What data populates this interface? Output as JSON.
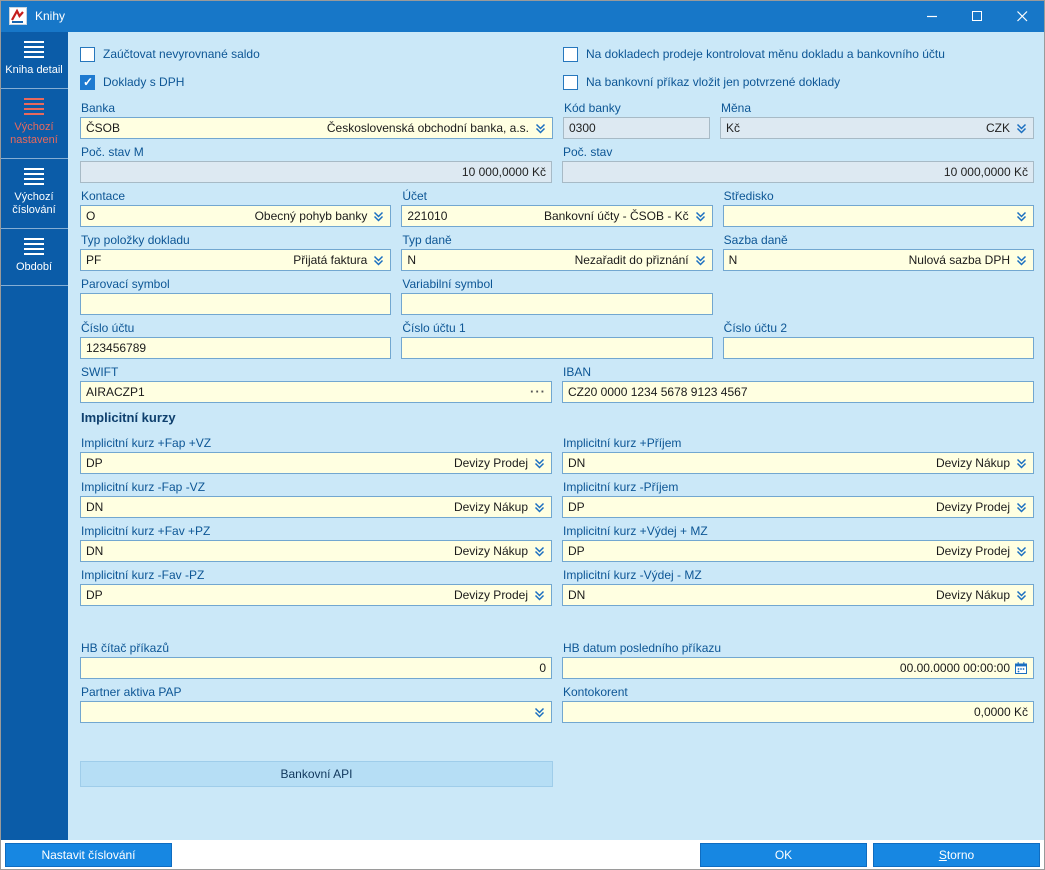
{
  "window": {
    "title": "Knihy"
  },
  "sidebar": {
    "items": [
      {
        "label": "Kniha detail",
        "active": false
      },
      {
        "label": "Výchozí nastavení",
        "active": true
      },
      {
        "label": "Výchozí číslování",
        "active": false
      },
      {
        "label": "Období",
        "active": false
      }
    ]
  },
  "checkboxes": {
    "saldo": {
      "label": "Zaúčtovat nevyrovnané saldo",
      "checked": false
    },
    "dph": {
      "label": "Doklady s DPH",
      "checked": true
    },
    "kontrola_meny": {
      "label": "Na dokladech prodeje kontrolovat měnu dokladu a bankovního účtu",
      "checked": false
    },
    "potvrzene_doklady": {
      "label": "Na bankovní příkaz vložit jen potvrzené doklady",
      "checked": false
    }
  },
  "fields": {
    "banka": {
      "label": "Banka",
      "code": "ČSOB",
      "name": "Československá obchodní banka, a.s."
    },
    "kod_banky": {
      "label": "Kód banky",
      "value": "0300"
    },
    "mena": {
      "label": "Měna",
      "code": "Kč",
      "name": "CZK"
    },
    "poc_stav_m": {
      "label": "Poč. stav M",
      "value": "10 000,0000 Kč"
    },
    "poc_stav": {
      "label": "Poč. stav",
      "value": "10 000,0000 Kč"
    },
    "kontace": {
      "label": "Kontace",
      "code": "O",
      "name": "Obecný pohyb banky"
    },
    "ucet": {
      "label": "Účet",
      "code": "221010",
      "name": "Bankovní účty - ČSOB - Kč"
    },
    "stredisko": {
      "label": "Středisko",
      "code": "",
      "name": ""
    },
    "typ_polozky_dokladu": {
      "label": "Typ položky dokladu",
      "code": "PF",
      "name": "Přijatá faktura"
    },
    "typ_dane": {
      "label": "Typ daně",
      "code": "N",
      "name": "Nezařadit do přiznání"
    },
    "sazba_dane": {
      "label": "Sazba daně",
      "code": "N",
      "name": "Nulová sazba DPH"
    },
    "parovaci_symbol": {
      "label": "Parovací symbol",
      "value": ""
    },
    "variabilni_symbol": {
      "label": "Variabilní symbol",
      "value": ""
    },
    "cislo_uctu": {
      "label": "Číslo účtu",
      "value": "123456789"
    },
    "cislo_uctu_1": {
      "label": "Číslo účtu 1",
      "value": ""
    },
    "cislo_uctu_2": {
      "label": "Číslo účtu 2",
      "value": ""
    },
    "swift": {
      "label": "SWIFT",
      "value": "AIRACZP1",
      "more": "···"
    },
    "iban": {
      "label": "IBAN",
      "value": "CZ20 0000 1234 5678 9123 4567"
    },
    "kurz_plus_fap_vz": {
      "label": "Implicitní kurz +Fap +VZ",
      "code": "DP",
      "name": "Devizy Prodej"
    },
    "kurz_plus_prijem": {
      "label": "Implicitní kurz +Příjem",
      "code": "DN",
      "name": "Devizy Nákup"
    },
    "kurz_minus_fap_vz": {
      "label": "Implicitní kurz -Fap -VZ",
      "code": "DN",
      "name": "Devizy Nákup"
    },
    "kurz_minus_prijem": {
      "label": "Implicitní kurz -Příjem",
      "code": "DP",
      "name": "Devizy Prodej"
    },
    "kurz_plus_fav_pz": {
      "label": "Implicitní kurz +Fav +PZ",
      "code": "DN",
      "name": "Devizy Nákup"
    },
    "kurz_plus_vydej_mz": {
      "label": "Implicitní kurz +Výdej + MZ",
      "code": "DP",
      "name": "Devizy Prodej"
    },
    "kurz_minus_fav_pz": {
      "label": "Implicitní kurz -Fav -PZ",
      "code": "DP",
      "name": "Devizy Prodej"
    },
    "kurz_minus_vydej_mz": {
      "label": "Implicitní kurz -Výdej - MZ",
      "code": "DN",
      "name": "Devizy Nákup"
    },
    "hb_citac_prikazu": {
      "label": "HB čítač příkazů",
      "value": "0"
    },
    "hb_datum_posledniho_prikazu": {
      "label": "HB datum posledního příkazu",
      "value": "00.00.0000 00:00:00"
    },
    "partner_aktiva_pap": {
      "label": "Partner aktiva PAP",
      "code": "",
      "name": ""
    },
    "kontokorent": {
      "label": "Kontokorent",
      "value": "0,0000 Kč"
    }
  },
  "sections": {
    "implicitni_kurzy": "Implicitní kurzy"
  },
  "buttons": {
    "bankovni_api": "Bankovní API",
    "nastavit_cislovani": "Nastavit číslování",
    "ok": "OK",
    "storno": "Storno"
  }
}
